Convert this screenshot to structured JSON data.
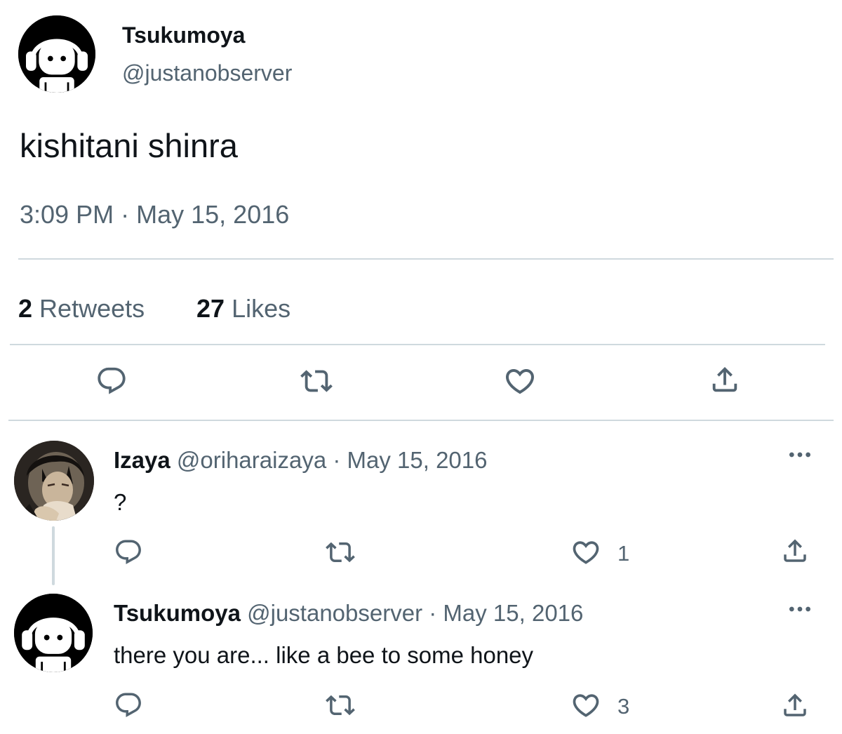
{
  "tweet": {
    "author_name": "Tsukumoya",
    "author_handle": "@justanobserver",
    "text": "kishitani shinra",
    "time": "3:09 PM",
    "separator": "·",
    "date": "May 15, 2016",
    "retweets_count": "2",
    "retweets_label": "Retweets",
    "likes_count": "27",
    "likes_label": "Likes"
  },
  "replies": [
    {
      "author_name": "Izaya",
      "author_handle": "@oriharaizaya",
      "separator": "·",
      "date": "May 15, 2016",
      "text": "?",
      "like_count": "1"
    },
    {
      "author_name": "Tsukumoya",
      "author_handle": "@justanobserver",
      "separator": "·",
      "date": "May 15, 2016",
      "text": "there you are... like a bee to some honey",
      "like_count": "3"
    }
  ],
  "icons": {
    "reply": "reply-icon",
    "retweet": "retweet-icon",
    "like": "heart-icon",
    "share": "share-icon",
    "more": "more-icon"
  },
  "colors": {
    "text": "#0f1419",
    "muted": "#536471",
    "divider": "#cfd9de"
  }
}
